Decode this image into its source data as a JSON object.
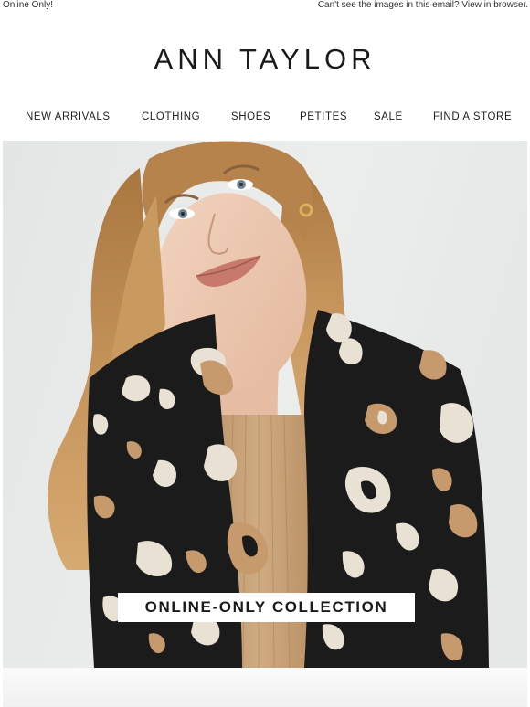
{
  "preheader": {
    "left_text": "Online Only!",
    "right_text": "Can't see the images in this email? View in browser."
  },
  "brand": {
    "logo_text": "ANN TAYLOR"
  },
  "nav": {
    "items": [
      {
        "label": "NEW ARRIVALS"
      },
      {
        "label": "CLOTHING"
      },
      {
        "label": "SHOES"
      },
      {
        "label": "PETITES"
      },
      {
        "label": "SALE"
      },
      {
        "label": "FIND A STORE"
      }
    ]
  },
  "hero": {
    "cta_label": "ONLINE-ONLY COLLECTION"
  },
  "colors": {
    "background": "#ffffff",
    "hero_backdrop": "#e9ebea",
    "sweater": "#1b1b1b",
    "spot_cream": "#e8e1d4",
    "spot_tan": "#c69a6c",
    "top_camel": "#c8a47b",
    "hair": "#b9874e",
    "skin": "#ecc9b2"
  }
}
